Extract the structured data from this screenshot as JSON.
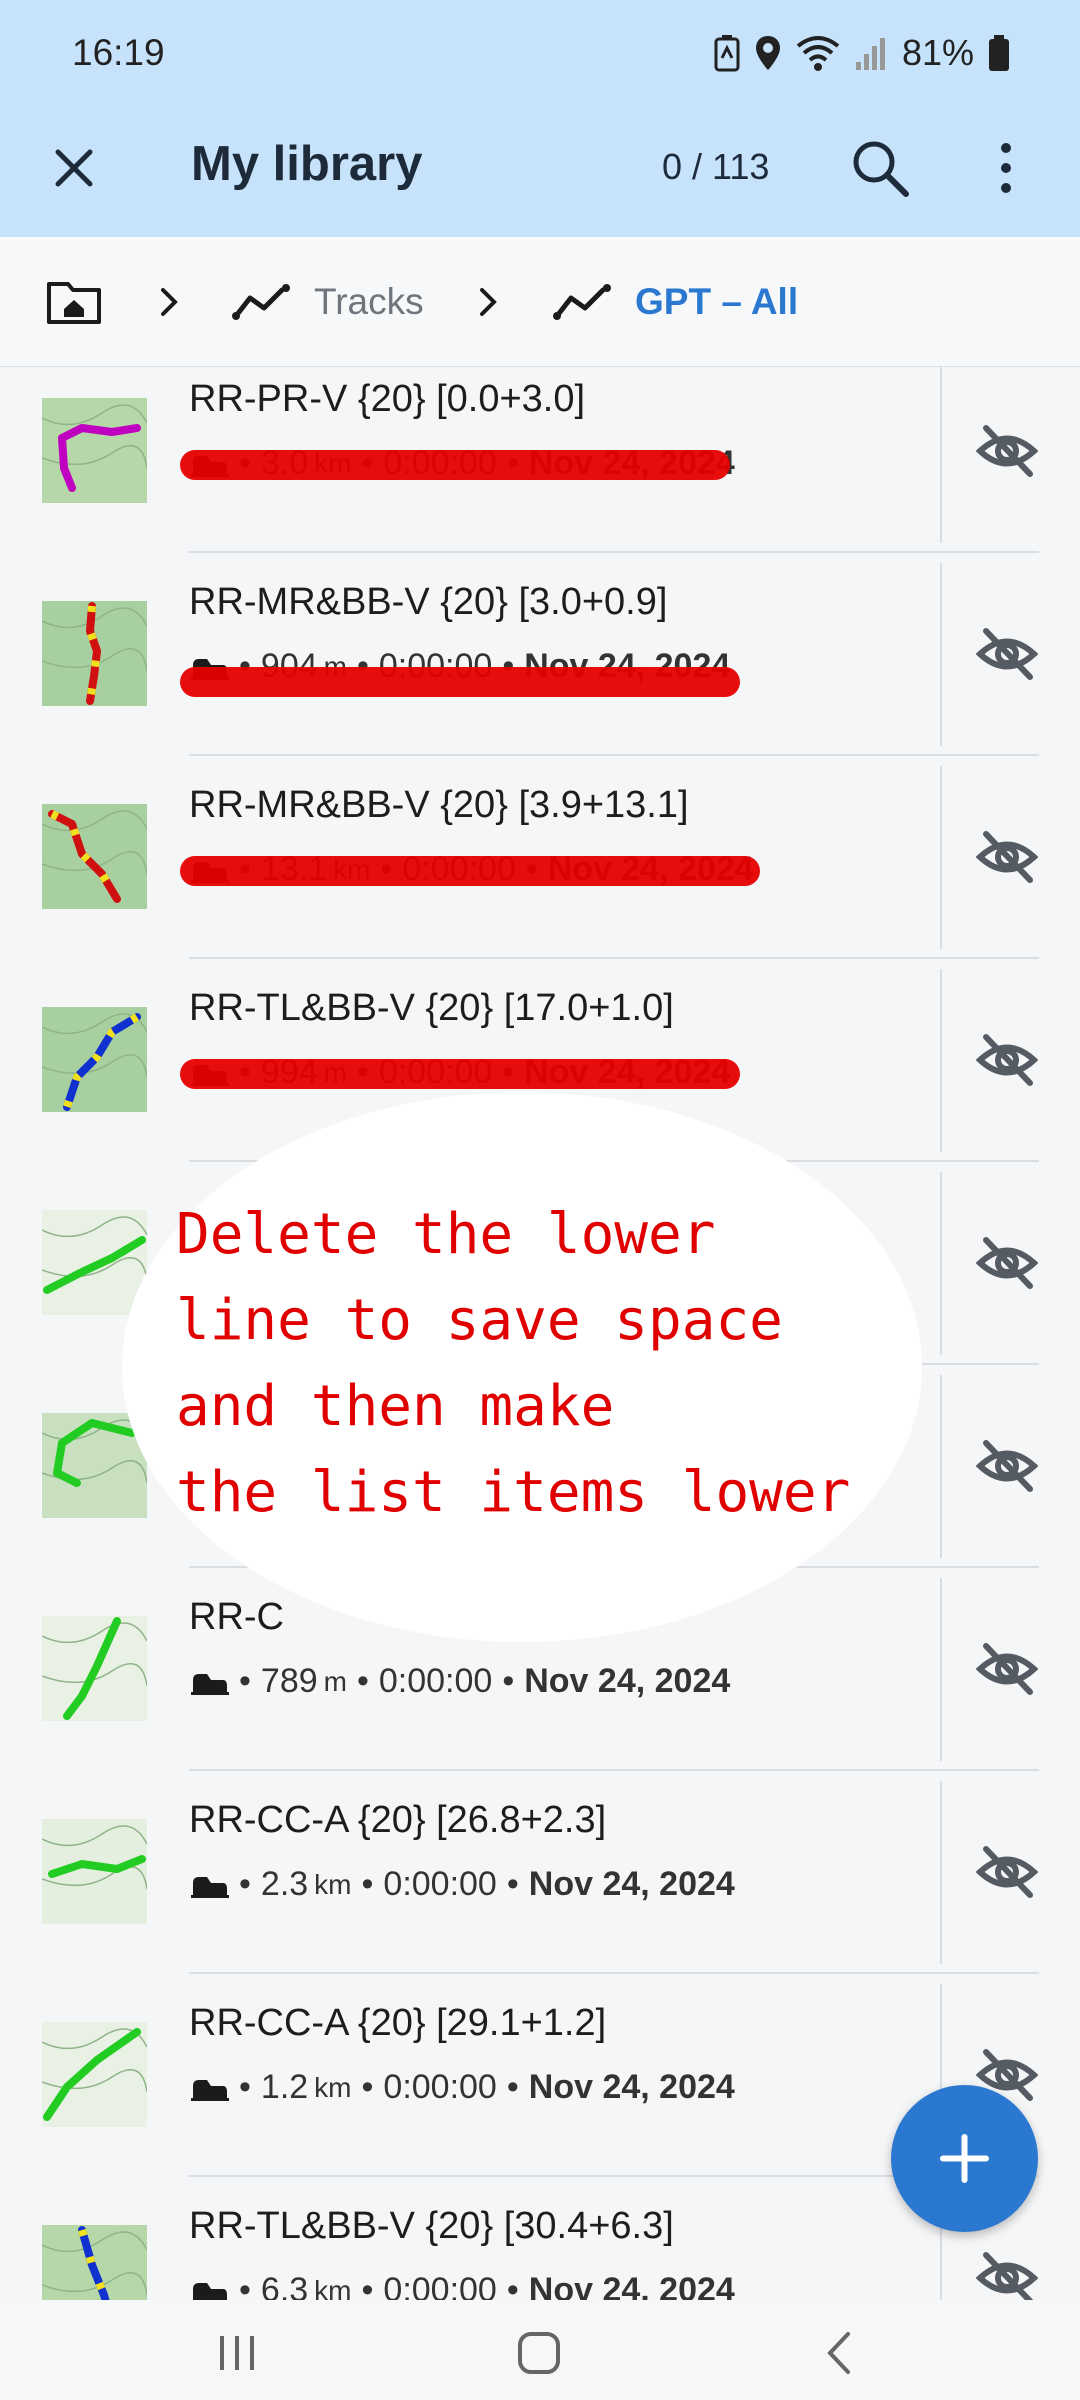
{
  "status_bar": {
    "time": "16:19",
    "battery_pct": "81%"
  },
  "app_bar": {
    "title": "My library",
    "count": "0 / 113"
  },
  "breadcrumb": {
    "crumbs": [
      "Tracks",
      "GPT – All"
    ]
  },
  "tracks": [
    {
      "name": "RR-PR-V {20} [0.0+3.0]",
      "distance": "3.0",
      "unit": "km",
      "duration": "0:00:00",
      "date": "Nov 24, 2024"
    },
    {
      "name": "RR-MR&BB-V {20} [3.0+0.9]",
      "distance": "904",
      "unit": "m",
      "duration": "0:00:00",
      "date": "Nov 24, 2024"
    },
    {
      "name": "RR-MR&BB-V {20} [3.9+13.1]",
      "distance": "13.1",
      "unit": "km",
      "duration": "0:00:00",
      "date": "Nov 24, 2024"
    },
    {
      "name": "RR-TL&BB-V {20} [17.0+1.0]",
      "distance": "994",
      "unit": "m",
      "duration": "0:00:00",
      "date": "Nov 24, 2024"
    },
    {
      "name": "",
      "distance": "",
      "unit": "",
      "duration": "",
      "date": ""
    },
    {
      "name": "",
      "distance": "",
      "unit": "",
      "duration": "",
      "date": ""
    },
    {
      "name": "RR-C",
      "distance": "789",
      "unit": "m",
      "duration": "0:00:00",
      "date": "Nov 24, 2024"
    },
    {
      "name": "RR-CC-A {20} [26.8+2.3]",
      "distance": "2.3",
      "unit": "km",
      "duration": "0:00:00",
      "date": "Nov 24, 2024"
    },
    {
      "name": "RR-CC-A {20} [29.1+1.2]",
      "distance": "1.2",
      "unit": "km",
      "duration": "0:00:00",
      "date": "Nov 24, 2024"
    },
    {
      "name": "RR-TL&BB-V {20} [30.4+6.3]",
      "distance": "6.3",
      "unit": "km",
      "duration": "0:00:00",
      "date": "Nov 24, 2024"
    }
  ],
  "annotation": {
    "line1": "Delete the lower",
    "line2": "line to save space",
    "line3": "and then make",
    "line4": "the list items lower"
  },
  "colors": {
    "accent": "#2b78d0",
    "appbar_bg": "#c7e2fb",
    "annotation": "#e00000"
  },
  "icons": [
    "close-icon",
    "search-icon",
    "more-vert-icon",
    "folder-home-icon",
    "chevron-right-icon",
    "track-icon",
    "hidden-eye-icon",
    "activity-icon",
    "plus-icon"
  ]
}
